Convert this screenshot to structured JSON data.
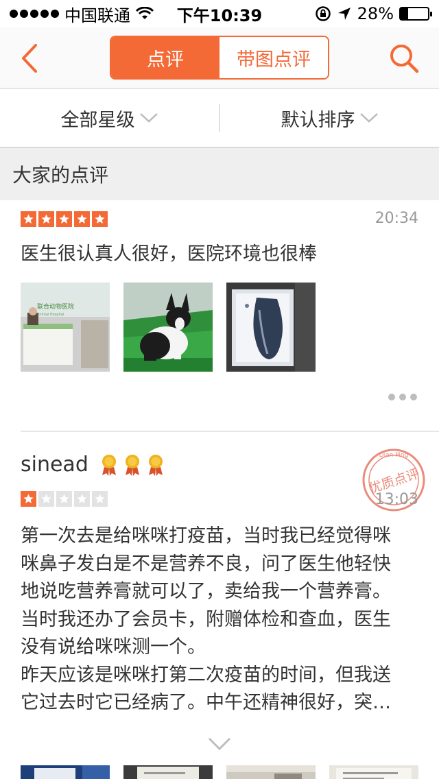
{
  "status_bar": {
    "carrier": "中国联通",
    "time": "下午10:39",
    "battery": "28%",
    "battery_level": 0.28
  },
  "nav": {
    "back_icon": "chevron-left-icon",
    "tabs": [
      {
        "label": "点评",
        "active": true
      },
      {
        "label": "带图点评",
        "active": false
      }
    ],
    "search_icon": "search-icon",
    "accent_color": "#f46a36"
  },
  "filters": {
    "rating": "全部星级",
    "sort": "默认排序"
  },
  "section_title": "大家的点评",
  "reviews": [
    {
      "rating": 5,
      "time": "20:34",
      "text": "医生很认真人很好，医院环境也很棒",
      "photo_texts": [
        "联合动物医院",
        "Animal Hospital"
      ]
    },
    {
      "user": "sinead",
      "medals": 3,
      "rating": 1,
      "time": "13:03",
      "badge": "优质点评",
      "badge_sub": "Dian Ping",
      "lines": [
        "第一次去是给咪咪打疫苗，当时我已经觉得咪",
        "咪鼻子发白是不是营养不良，问了医生他轻快",
        "地说吃营养膏就可以了，卖给我一个营养膏。",
        "当时我还办了会员卡，附赠体检和查血，医生",
        "没有说给咪咪测一个。",
        "昨天应该是咪咪打第二次疫苗的时间，但我送",
        "它过去时它已经病了。中午还精神很好，突…"
      ]
    }
  ]
}
